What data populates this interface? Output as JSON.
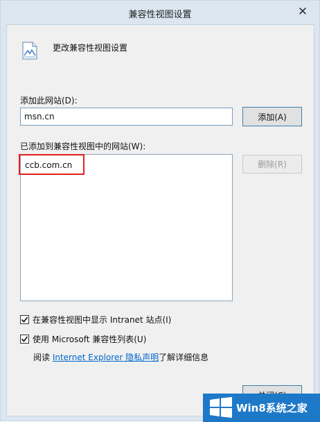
{
  "window": {
    "title": "兼容性视图设置"
  },
  "header": {
    "text": "更改兼容性视图设置"
  },
  "add_site": {
    "label": "添加此网站(D):",
    "value": "msn.cn",
    "add_button": "添加(A)"
  },
  "site_list": {
    "label": "已添加到兼容性视图中的网站(W):",
    "items": [
      "ccb.com.cn"
    ],
    "remove_button": "删除(R)"
  },
  "options": {
    "show_intranet": {
      "label": "在兼容性视图中显示 Intranet 站点(I)",
      "checked": true
    },
    "use_ms_list": {
      "label": "使用 Microsoft 兼容性列表(U)",
      "checked": true
    }
  },
  "info": {
    "prefix": "阅读 ",
    "link": "Internet Explorer 隐私声明",
    "suffix": "了解详细信息"
  },
  "footer": {
    "close_button": "关闭(C)"
  },
  "watermark": {
    "text": "Win8系统之家"
  },
  "colors": {
    "accent": "#0066cc",
    "highlight": "#e02020",
    "watermark_bg": "#1e78c8"
  },
  "icons": {
    "header": "compatibility-view-icon",
    "title_close": "close-icon",
    "check": "checkmark-icon",
    "watermark_logo": "windows-logo-icon"
  }
}
